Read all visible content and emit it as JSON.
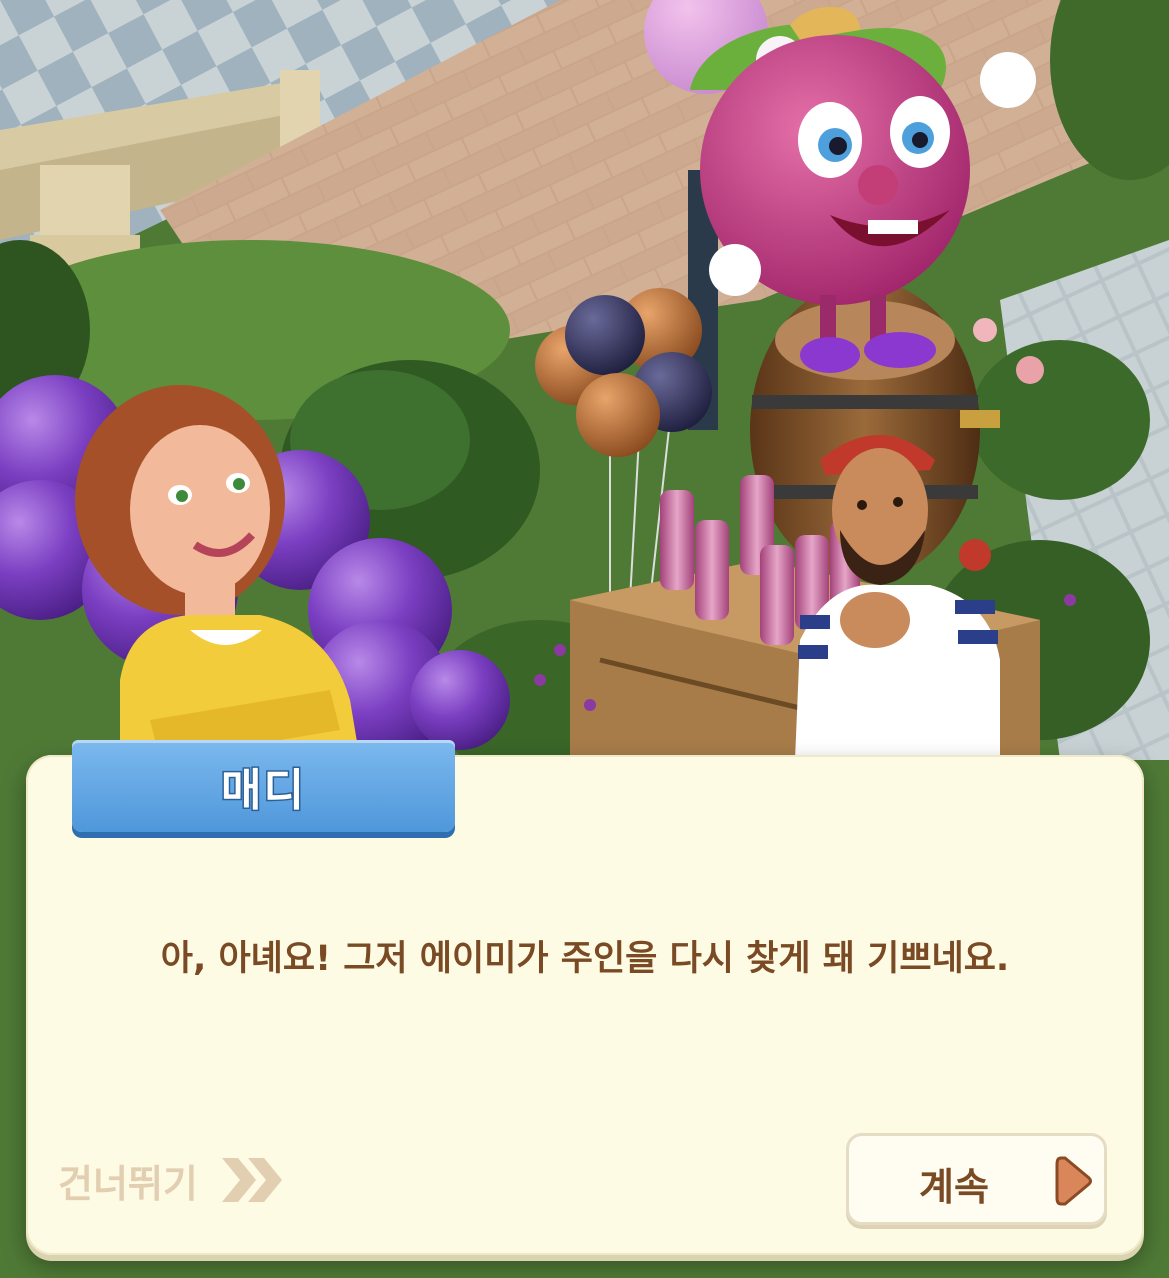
{
  "dialog": {
    "speaker": "매디",
    "message": "아, 아녜요! 그저 에이미가 주인을 다시 찾게 돼 기쁘네요.",
    "skip_label": "건너뛰기",
    "continue_label": "계속"
  },
  "icons": {
    "skip": "double-chevron-right-icon",
    "continue": "play-triangle-icon"
  },
  "colors": {
    "dialog_bg": "#fdfbe4",
    "name_tab": "#5aa3e2",
    "message_text": "#7a4a24",
    "skip_text": "#e2cfb2",
    "continue_arrow": "#d9875a"
  }
}
